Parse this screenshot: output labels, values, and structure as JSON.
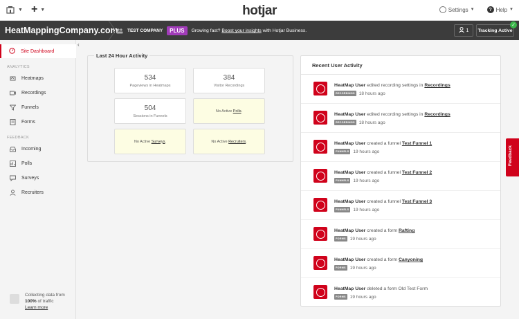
{
  "topbar": {
    "logo": "hotjar",
    "settings_label": "Settings",
    "help_label": "Help"
  },
  "header": {
    "site_name": "HeatMappingCompany.com",
    "team_name": "TEST COMPANY",
    "plan_badge": "PLUS",
    "growing_text": "Growing fast?",
    "boost_link": "Boost your insights",
    "boost_suffix": "with Hotjar Business.",
    "notifications_count": "1",
    "tracking_label": "Tracking Active"
  },
  "sidebar": {
    "dashboard_label": "Site Dashboard",
    "analytics_heading": "ANALYTICS",
    "feedback_heading": "FEEDBACK",
    "items": [
      {
        "label": "Heatmaps"
      },
      {
        "label": "Recordings"
      },
      {
        "label": "Funnels"
      },
      {
        "label": "Forms"
      },
      {
        "label": "Incoming"
      },
      {
        "label": "Polls"
      },
      {
        "label": "Surveys"
      },
      {
        "label": "Recruiters"
      }
    ],
    "collecting_line1": "Collecting data from",
    "collecting_pct": "100%",
    "collecting_suffix": "of traffic",
    "learn_more": "Learn more"
  },
  "activity": {
    "title": "Last 24 Hour Activity",
    "pageviews_value": "534",
    "pageviews_label": "Pageviews in Heatmaps",
    "recordings_value": "384",
    "recordings_label": "Visitor Recordings",
    "funnels_value": "504",
    "funnels_label": "Sessions in Funnels",
    "polls_prefix": "No Active",
    "polls_link": "Polls",
    "surveys_prefix": "No Active",
    "surveys_link": "Surveys",
    "recruiters_prefix": "No Active",
    "recruiters_link": "Recruiters"
  },
  "recent": {
    "title": "Recent User Activity",
    "rows": [
      {
        "user": "HeatMap User",
        "action": "edited recording settings in",
        "target": "Recordings",
        "tag": "RECORDINGS",
        "time": "18 hours ago"
      },
      {
        "user": "HeatMap User",
        "action": "edited recording settings in",
        "target": "Recordings",
        "tag": "RECORDINGS",
        "time": "18 hours ago"
      },
      {
        "user": "HeatMap User",
        "action": "created a funnel",
        "target": "Test Funnel 1",
        "tag": "FUNNELS",
        "time": "19 hours ago"
      },
      {
        "user": "HeatMap User",
        "action": "created a funnel",
        "target": "Test Funnel 2",
        "tag": "FUNNELS",
        "time": "19 hours ago"
      },
      {
        "user": "HeatMap User",
        "action": "created a funnel",
        "target": "Test Funnel 3",
        "tag": "FUNNELS",
        "time": "19 hours ago"
      },
      {
        "user": "HeatMap User",
        "action": "created a form",
        "target": "Rafting",
        "tag": "FORMS",
        "time": "19 hours ago"
      },
      {
        "user": "HeatMap User",
        "action": "created a form",
        "target": "Canyoning",
        "tag": "FORMS",
        "time": "19 hours ago"
      },
      {
        "user": "HeatMap User",
        "action": "deleted a form Old Test Form",
        "target": "",
        "tag": "FORMS",
        "time": "19 hours ago"
      }
    ]
  },
  "feedback_tab": "Feedback",
  "colors": {
    "brand_red": "#d0021b",
    "plus_purple": "#a23cba",
    "dark_bar": "#3c3c3c",
    "tracking_green": "#3bb54a",
    "empty_card_yellow": "#fdfde3"
  }
}
